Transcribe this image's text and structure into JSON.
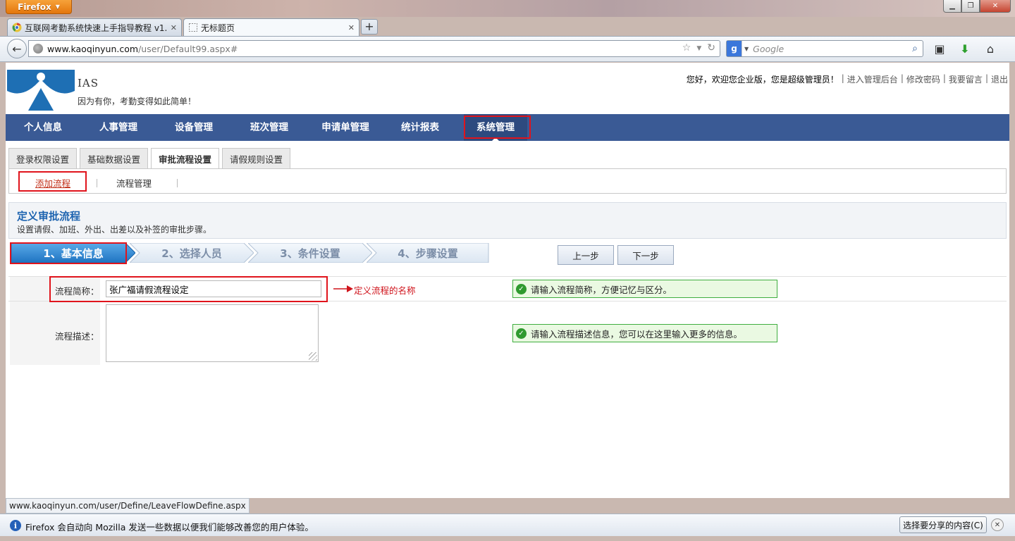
{
  "browser": {
    "app_button": "Firefox",
    "tabs": [
      {
        "label": "互联网考勤系统快速上手指导教程 v1..."
      },
      {
        "label": "无标题页"
      }
    ],
    "url_host": "www.kaoqinyun.com",
    "url_path": "/user/Default99.aspx#",
    "search_placeholder": "Google",
    "status_url": "www.kaoqinyun.com/user/Define/LeaveFlowDefine.aspx",
    "notification": "Firefox 会自动向 Mozilla 发送一些数据以便我们能够改善您的用户体验。",
    "share_button": "选择要分享的内容(C)"
  },
  "header": {
    "brand": "IAS",
    "slogan": "因为有你，考勤变得如此简单！",
    "greeting": "您好，欢迎您企业版，您是超级管理员！",
    "links": [
      "进入管理后台",
      "修改密码",
      "我要留言",
      "退出"
    ]
  },
  "main_nav": [
    "个人信息",
    "人事管理",
    "设备管理",
    "班次管理",
    "申请单管理",
    "统计报表",
    "系统管理"
  ],
  "sub_tabs": [
    "登录权限设置",
    "基础数据设置",
    "审批流程设置",
    "请假规则设置"
  ],
  "sub_links": [
    "添加流程",
    "流程管理"
  ],
  "section": {
    "title": "定义审批流程",
    "description": "设置请假、加班、外出、出差以及补签的审批步骤。"
  },
  "steps": [
    "1、基本信息",
    "2、选择人员",
    "3、条件设置",
    "4、步骤设置"
  ],
  "buttons": {
    "prev": "上一步",
    "next": "下一步"
  },
  "form": {
    "name_label": "流程简称：",
    "name_value": "张广福请假流程设定",
    "desc_label": "流程描述：",
    "desc_value": "",
    "annotation": "定义流程的名称",
    "name_hint": "请输入流程简称，方便记忆与区分。",
    "desc_hint": "请输入流程描述信息，您可以在这里输入更多的信息。"
  },
  "colors": {
    "nav_bg": "#3a5a95",
    "step_active": "#2f86d0",
    "highlight": "#e0141c",
    "hint_border": "#3fae3f"
  }
}
